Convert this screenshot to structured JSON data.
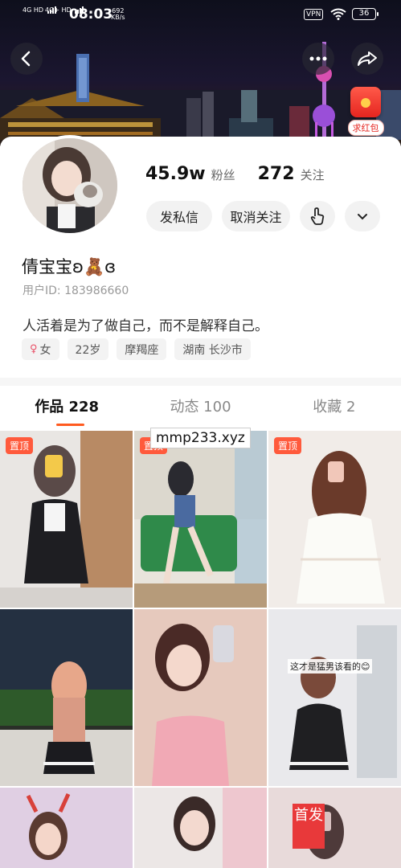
{
  "status_bar": {
    "net1": "4G HD",
    "net2": "4G+ HD",
    "time": "08:03",
    "speed_value": "692",
    "speed_unit": "KB/s",
    "vpn": "VPN",
    "battery": "36"
  },
  "header": {
    "back_icon": "back-chevron-icon",
    "more_icon": "more-dots-icon",
    "share_icon": "share-arrow-icon",
    "red_packet_label": "求红包"
  },
  "profile": {
    "followers_count": "45.9w",
    "followers_label": "粉丝",
    "following_count": "272",
    "following_label": "关注",
    "message_button": "发私信",
    "unfollow_button": "取消关注",
    "nickname": "倩宝宝ʚ🧸ɞ",
    "user_id": "用户ID: 183986660",
    "bio": "人活着是为了做自己，而不是解释自己。",
    "tags": {
      "gender": "女",
      "age": "22岁",
      "zodiac": "摩羯座",
      "location": "湖南 长沙市"
    }
  },
  "tabs": [
    {
      "label": "作品 228",
      "active": true
    },
    {
      "label": "动态 100",
      "active": false
    },
    {
      "label": "收藏 2",
      "active": false
    }
  ],
  "grid": {
    "pinned_label": "置顶",
    "caption_cell_6": "这才是猛男该看的😊",
    "stamp_text": "首发",
    "watermark": "mmp233.xyz"
  },
  "colors": {
    "accent": "#ff5a1f",
    "pin_badge": "#ff5a3c",
    "red_packet": "#e5251f"
  }
}
